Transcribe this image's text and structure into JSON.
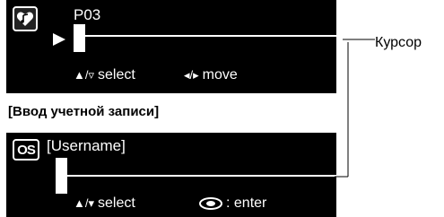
{
  "screen1": {
    "icon": "music-note-heart-icon",
    "title": "P03",
    "hint_select_glyph": "▲/▿",
    "hint_select": "select",
    "hint_move_glyph": "◂/▸",
    "hint_move": "move"
  },
  "section_heading": "[Ввод учетной записи]",
  "screen2": {
    "icon": "os-icon",
    "icon_text": "OS",
    "title": "[Username]",
    "hint_select_glyph": "▲/▾",
    "hint_select": "select",
    "hint_enter_icon": "eye-button-icon",
    "hint_enter": ": enter"
  },
  "callout": {
    "label": "Курсор"
  },
  "colors": {
    "screen_bg": "#000000",
    "screen_fg": "#ffffff",
    "page_bg": "#ffffff"
  }
}
